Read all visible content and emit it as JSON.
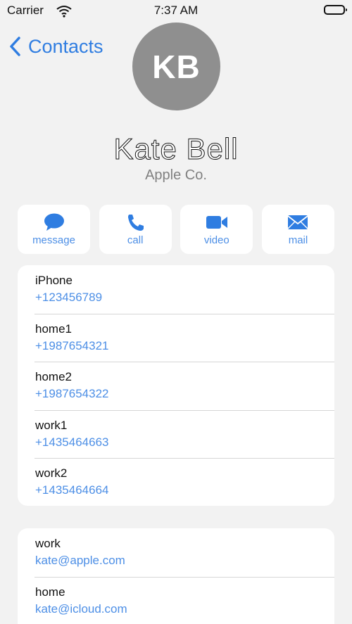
{
  "status_bar": {
    "carrier": "Carrier",
    "time": "7:37 AM",
    "wifi_icon": "wifi-icon",
    "battery_icon": "battery-icon"
  },
  "nav": {
    "back_label": "Contacts",
    "back_icon": "chevron-left-icon"
  },
  "contact": {
    "initials": "KB",
    "name": "Kate Bell",
    "company": "Apple Co."
  },
  "actions": [
    {
      "label": "message",
      "icon": "message-bubble-icon"
    },
    {
      "label": "call",
      "icon": "phone-icon"
    },
    {
      "label": "video",
      "icon": "video-camera-icon"
    },
    {
      "label": "mail",
      "icon": "envelope-icon"
    }
  ],
  "phones": [
    {
      "label": "iPhone",
      "value": "+123456789"
    },
    {
      "label": "home1",
      "value": "+1987654321"
    },
    {
      "label": "home2",
      "value": "+1987654322"
    },
    {
      "label": "work1",
      "value": "+1435464663"
    },
    {
      "label": "work2",
      "value": "+1435464664"
    }
  ],
  "emails": [
    {
      "label": "work",
      "value": "kate@apple.com"
    },
    {
      "label": "home",
      "value": "kate@icloud.com"
    }
  ],
  "colors": {
    "accent": "#2f7de1",
    "background": "#f2f2f2",
    "avatar": "#8f8f8f"
  }
}
